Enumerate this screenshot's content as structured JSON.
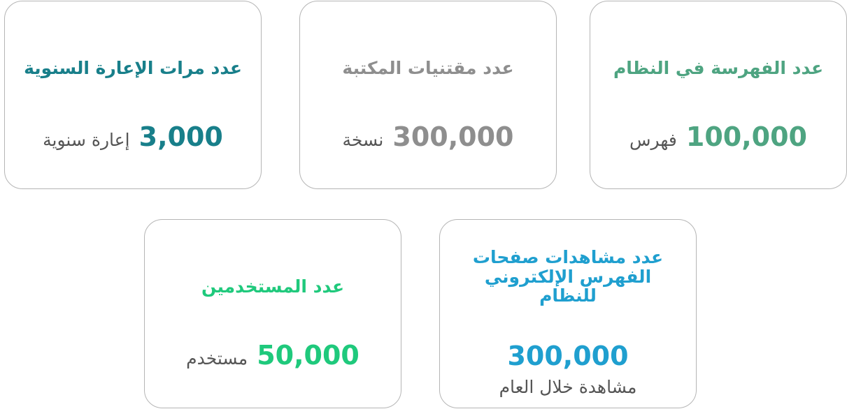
{
  "cards": [
    {
      "title": "عدد الفهرسة في النظام",
      "value": "100,000",
      "unit": "فهرس",
      "color": "#4ea481"
    },
    {
      "title": "عدد مقتنيات المكتبة",
      "value": "300,000",
      "unit": "نسخة",
      "color": "#8e8e8e"
    },
    {
      "title": "عدد مرات الإعارة السنوية",
      "value": "3,000",
      "unit": "إعارة سنوية",
      "color": "#187f8a"
    },
    {
      "title": "عدد مشاهدات صفحات الفهرس الإلكتروني للنظام",
      "value": "300,000",
      "unit": "مشاهدة خلال العام",
      "color": "#1f9fcf"
    },
    {
      "title": "عدد المستخدمين",
      "value": "50,000",
      "unit": "مستخدم",
      "color": "#1fc97c"
    }
  ]
}
